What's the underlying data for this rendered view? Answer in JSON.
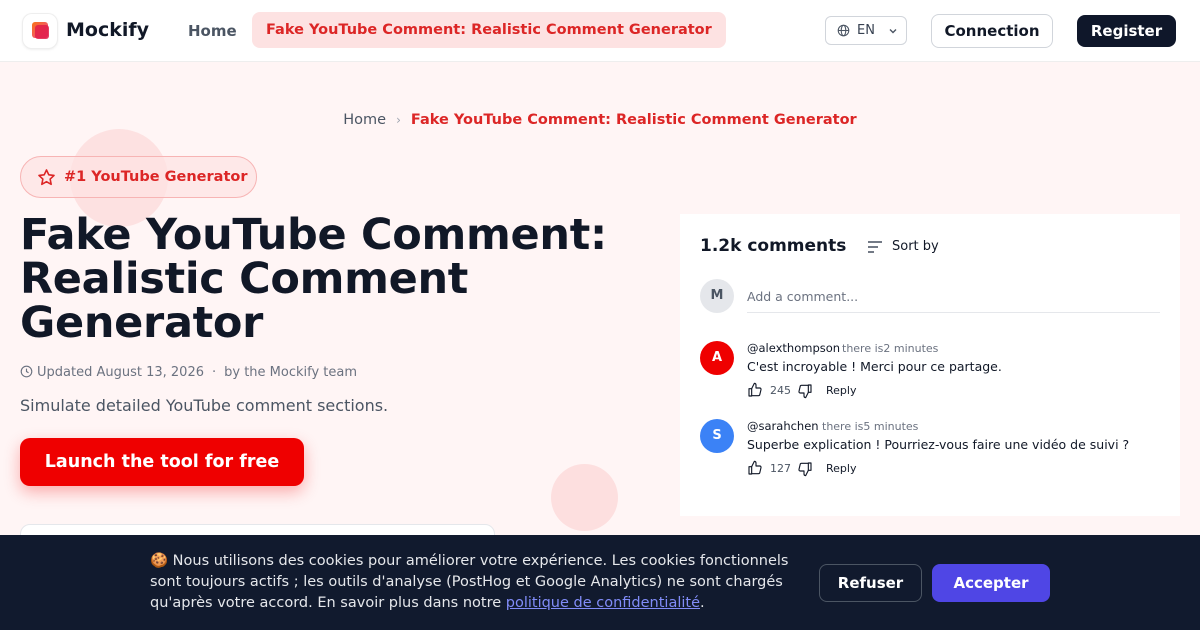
{
  "header": {
    "brand": "Mockify",
    "nav_home": "Home",
    "nav_active": "Fake YouTube Comment: Realistic Comment Generator",
    "lang": "EN",
    "connection": "Connection",
    "register": "Register"
  },
  "breadcrumb": {
    "home": "Home",
    "separator": "›",
    "current": "Fake YouTube Comment: Realistic Comment Generator"
  },
  "hero": {
    "badge": "#1 YouTube Generator",
    "title": "Fake YouTube Comment: Realistic Comment Generator",
    "updated": "Updated August 13, 2026",
    "meta_sep": "·",
    "author": "by the Mockify team",
    "subtitle": "Simulate detailed YouTube comment sections.",
    "cta": "Launch the tool for free"
  },
  "comments_panel": {
    "count": "1.2k comments",
    "sort_by": "Sort by",
    "current_user_initial": "M",
    "add_placeholder": "Add a comment...",
    "reply_label": "Reply",
    "comments": [
      {
        "initial": "A",
        "color": "#ef0000",
        "author": "@alexthompson",
        "time": "there is2 minutes",
        "text": "C'est incroyable ! Merci pour ce partage.",
        "likes": "245"
      },
      {
        "initial": "S",
        "color": "#3b82f6",
        "author": "@sarahchen",
        "time": "there is5 minutes",
        "text": "Superbe explication ! Pourriez-vous faire une vidéo de suivi ?",
        "likes": "127"
      }
    ]
  },
  "cookie": {
    "emoji": "🍪",
    "text": "Nous utilisons des cookies pour améliorer votre expérience. Les cookies fonctionnels sont toujours actifs ; les outils d'analyse (PostHog et Google Analytics) ne sont chargés qu'après votre accord. En savoir plus dans notre",
    "link": "politique de confidentialité",
    "end": ".",
    "refuse": "Refuser",
    "accept": "Accepter"
  },
  "colors": {
    "brand_red": "#ef0000",
    "accent_indigo": "#4f46e5",
    "dark": "#0f172a"
  }
}
